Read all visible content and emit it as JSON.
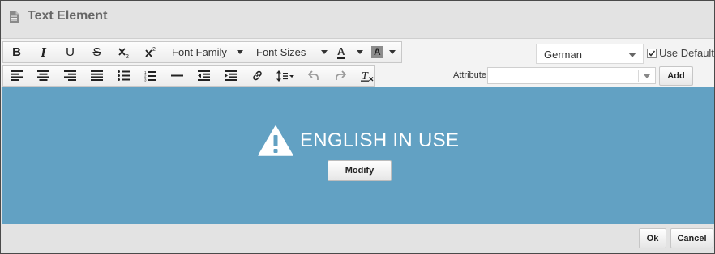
{
  "header": {
    "title": "Text Element",
    "icon": "document-icon"
  },
  "toolbar": {
    "bold_label": "B",
    "italic_label": "I",
    "underline_label": "U",
    "strike_label": "S",
    "font_family": "Font Family",
    "font_sizes": "Font Sizes",
    "text_color_label": "A",
    "bg_color_label": "A"
  },
  "language": {
    "selected": "German",
    "use_default_label": "Use Default",
    "use_default_checked": true
  },
  "attribute": {
    "label": "Attribute",
    "value": "",
    "add_label": "Add"
  },
  "editor": {
    "warning_text": "ENGLISH IN USE",
    "modify_label": "Modify",
    "background": "#62a1c3"
  },
  "footer": {
    "ok_label": "Ok",
    "cancel_label": "Cancel"
  }
}
